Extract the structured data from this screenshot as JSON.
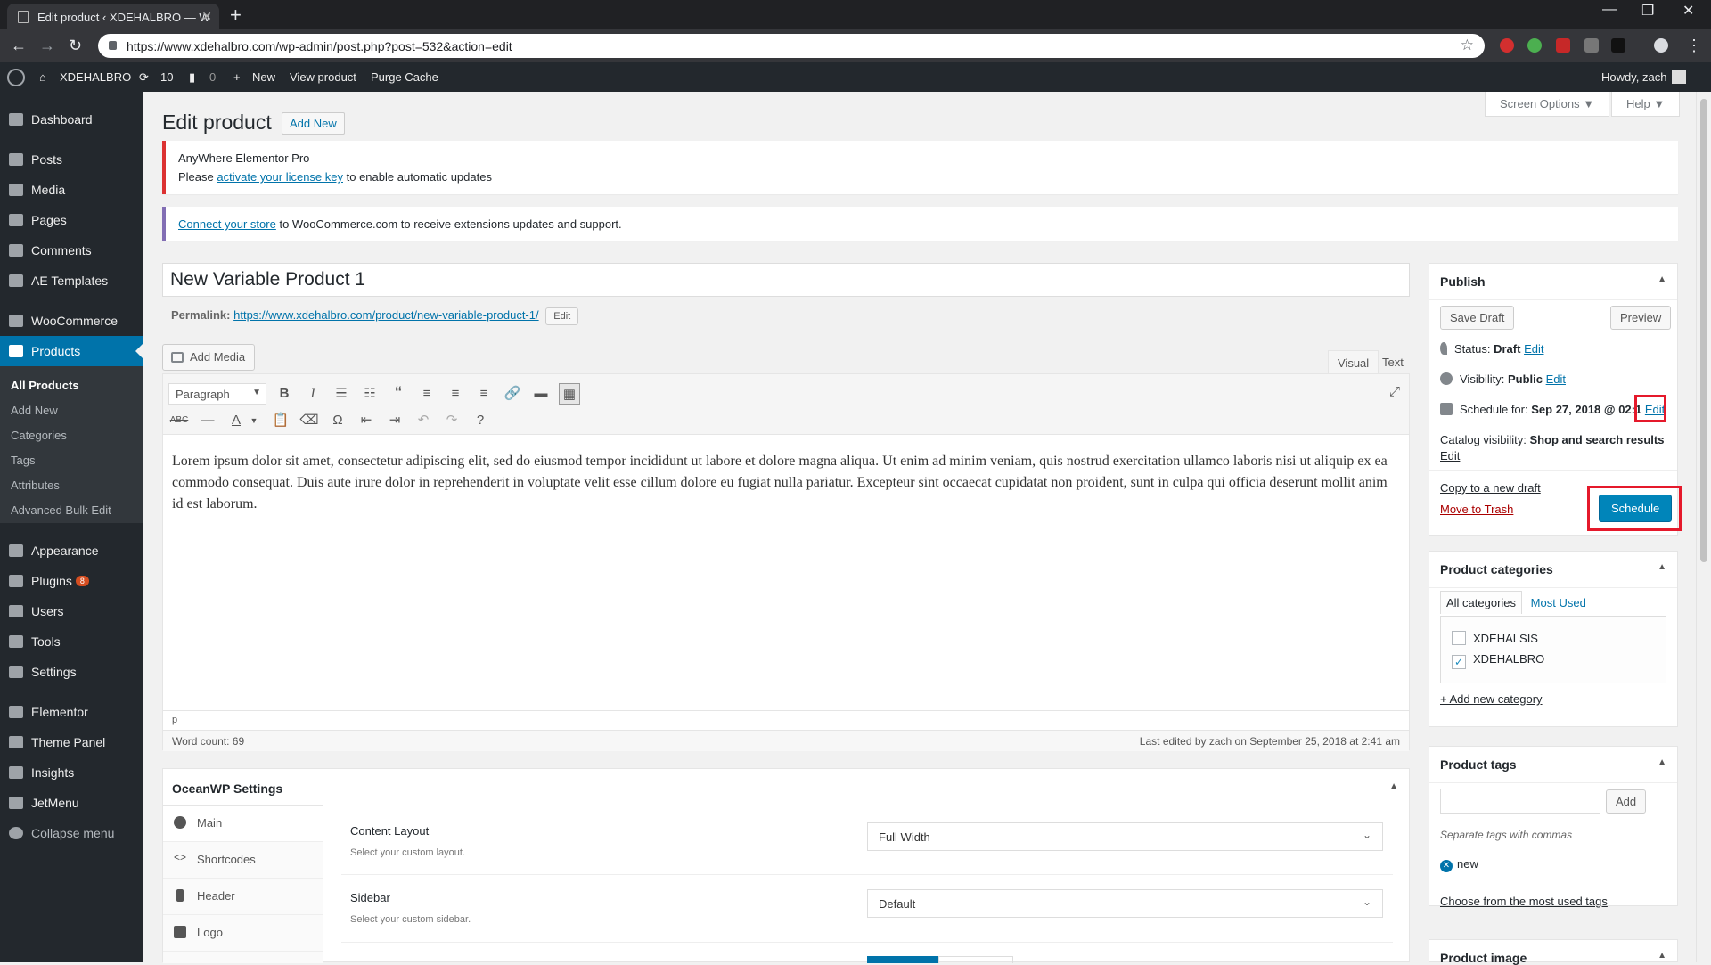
{
  "browser": {
    "tab_title": "Edit product ‹ XDEHALBRO — W",
    "url": "https://www.xdehalbro.com/wp-admin/post.php?post=532&action=edit"
  },
  "admin_bar": {
    "site_name": "XDEHALBRO",
    "updates_count": "10",
    "comments_count": "0",
    "new_label": "New",
    "view_product": "View product",
    "purge_cache": "Purge Cache",
    "howdy": "Howdy, zach"
  },
  "sidebar": {
    "items": [
      {
        "label": "Dashboard"
      },
      {
        "label": "Posts"
      },
      {
        "label": "Media"
      },
      {
        "label": "Pages"
      },
      {
        "label": "Comments"
      },
      {
        "label": "AE Templates"
      },
      {
        "label": "WooCommerce"
      },
      {
        "label": "Products"
      },
      {
        "label": "Appearance"
      },
      {
        "label": "Plugins",
        "badge": "8"
      },
      {
        "label": "Users"
      },
      {
        "label": "Tools"
      },
      {
        "label": "Settings"
      },
      {
        "label": "Elementor"
      },
      {
        "label": "Theme Panel"
      },
      {
        "label": "Insights"
      },
      {
        "label": "JetMenu"
      },
      {
        "label": "Collapse menu"
      }
    ],
    "products_submenu": [
      "All Products",
      "Add New",
      "Categories",
      "Tags",
      "Attributes",
      "Advanced Bulk Edit"
    ]
  },
  "header": {
    "title": "Edit product",
    "add_new": "Add New",
    "screen_options": "Screen Options ▼",
    "help": "Help ▼"
  },
  "notices": {
    "elementor_title": "AnyWhere Elementor Pro",
    "elementor_pre": "Please",
    "elementor_link": "activate your license key",
    "elementor_post": "to enable automatic updates",
    "woo_link": "Connect your store",
    "woo_text": "to WooCommerce.com to receive extensions updates and support."
  },
  "post": {
    "title": "New Variable Product 1",
    "permalink_label": "Permalink:",
    "permalink_url": "https://www.xdehalbro.com/product/new-variable-product-1/",
    "permalink_edit": "Edit"
  },
  "editor": {
    "add_media": "Add Media",
    "tab_visual": "Visual",
    "tab_text": "Text",
    "format": "Paragraph",
    "content": "Lorem ipsum dolor sit amet, consectetur adipiscing elit, sed do eiusmod tempor incididunt ut labore et dolore magna aliqua. Ut enim ad minim veniam, quis nostrud exercitation ullamco laboris nisi ut aliquip ex ea commodo consequat. Duis aute irure dolor in reprehenderit in voluptate velit esse cillum dolore eu fugiat nulla pariatur. Excepteur sint occaecat cupidatat non proident, sunt in culpa qui officia deserunt mollit anim id est laborum.",
    "path": "p",
    "word_count": "Word count: 69",
    "last_edited": "Last edited by zach on September 25, 2018 at 2:41 am"
  },
  "oceanwp": {
    "title": "OceanWP Settings",
    "tabs": [
      "Main",
      "Shortcodes",
      "Header",
      "Logo"
    ],
    "fields": [
      {
        "label": "Content Layout",
        "desc": "Select your custom layout.",
        "value": "Full Width"
      },
      {
        "label": "Sidebar",
        "desc": "Select your custom sidebar.",
        "value": "Default"
      }
    ]
  },
  "publish": {
    "title": "Publish",
    "save_draft": "Save Draft",
    "preview": "Preview",
    "status_label": "Status:",
    "status_value": "Draft",
    "visibility_label": "Visibility:",
    "visibility_value": "Public",
    "schedule_label": "Schedule for:",
    "schedule_value": "Sep 27, 2018 @ 02:1",
    "edit": "Edit",
    "catalog_label": "Catalog visibility:",
    "catalog_value": "Shop and search results",
    "copy_draft": "Copy to a new draft",
    "move_trash": "Move to Trash",
    "schedule_button": "Schedule"
  },
  "categories": {
    "title": "Product categories",
    "tab_all": "All categories",
    "tab_most_used": "Most Used",
    "items": [
      {
        "name": "XDEHALSIS",
        "checked": false
      },
      {
        "name": "XDEHALBRO",
        "checked": true
      }
    ],
    "add_new": "+ Add new category"
  },
  "tags": {
    "title": "Product tags",
    "add_button": "Add",
    "hint": "Separate tags with commas",
    "tag": "new",
    "choose_link": "Choose from the most used tags"
  },
  "image_box": {
    "title": "Product image"
  },
  "colors": {
    "wp_blue": "#0073aa",
    "admin_dark": "#23282d",
    "highlight_red": "#e5192b"
  }
}
